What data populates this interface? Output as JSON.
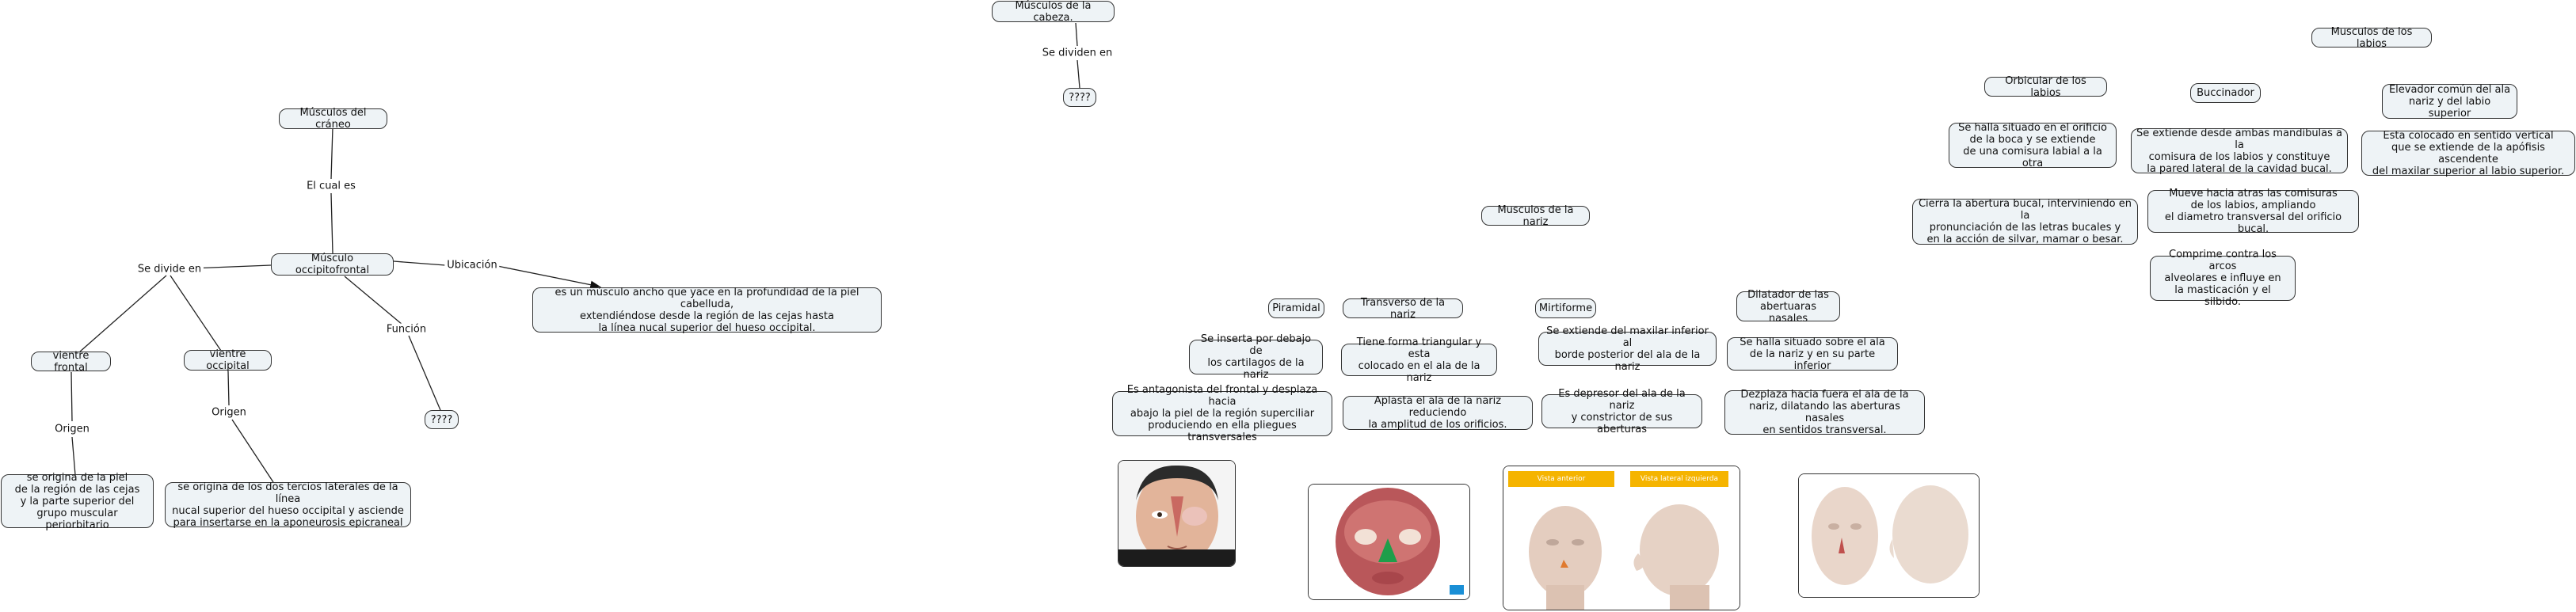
{
  "nodes": {
    "cabeza": "Músculos de la cabeza.",
    "q_top": "????",
    "craneo": "Músculos del cráneo",
    "occipitofrontal": "Músculo occipitofrontal",
    "vientre_frontal": "vientre frontal",
    "vientre_occipital": "vientre occipital",
    "q_funcion": "????",
    "ubicacion_desc": "es un músculo ancho que yace en la profundidad de la piel cabelluda,\nextendiéndose desde la región de las cejas hasta\nla línea nucal superior del hueso occipital.",
    "origen_frontal": "se origina de la piel\nde la región de las cejas\ny la parte superior del\ngrupo muscular periorbitario",
    "origen_occipital": "se origina de los dos tercios laterales de la línea\nnucal superior del hueso occipital y asciende\npara insertarse en la aponeurosis epicraneal",
    "nariz": "Musculos de la nariz",
    "piramidal": "Piramidal",
    "transverso": "Transverso de la nariz",
    "mirtiforme": "Mirtiforme",
    "dilatador": "Dilatador de las\nabertuaras nasales",
    "piramidal_1": "Se inserta por debajo de\nlos cartilagos de la nariz",
    "piramidal_2": "Es antagonista del frontal y desplaza hacia\nabajo la piel de la región superciliar\nproduciendo en ella pliegues transversales",
    "transverso_1": "Tiene forma triangular y esta\ncolocado en el ala de la nariz",
    "transverso_2": "Aplasta el ala de la nariz reduciendo\nla amplitud de los orificios.",
    "mirtiforme_1": "Se extiende del maxilar inferior al\nborde posterior del ala de la nariz",
    "mirtiforme_2": "Es depresor del ala de la nariz\ny constrictor de sus aberturas",
    "dilatador_1": "Se halla situado sobre el ala\nde la nariz y en su parte inferior",
    "dilatador_2": "Dezplaza hacia fuera el ala de la\nnariz, dilatando las aberturas nasales\nen sentidos transversal.",
    "labios": "Musculos de los labios",
    "orbicular": "Orbicular de los labios",
    "buccinador": "Buccinador",
    "elevador": "Elevador común del ala\nnariz y del labio superior",
    "orbicular_1": "Se halla situado en el orificio\nde la boca y se extiende\nde una comisura labial a la otra",
    "orbicular_2": "Cierra la abertura bucal, interviniendo en la\npronunciación de las letras bucales y\nen la acción de silvar, mamar o besar.",
    "buccinador_1": "Se extiende desde ambas mandibulas a la\ncomisura de los labios y constituye\nla pared lateral de la cavidad bucal.",
    "buccinador_2": "Mueve hacia atras las comisuras\nde los labios, ampliando\nel diametro transversal del orificio bucal.",
    "buccinador_3": "Comprime contra los arcos\nalveolares e influye en\nla masticación y el silbido.",
    "elevador_1": "Esta colocado en sentido vertical\nque se extiende de la apófisis ascendente\ndel maxilar superior al labio superior."
  },
  "links": {
    "se_dividen_en": "Se dividen en",
    "el_cual_es": "El cual es",
    "se_divide_en": "Se divide en",
    "ubicacion": "Ubicación",
    "funcion": "Función",
    "origen_1": "Origen",
    "origen_2": "Origen"
  },
  "image_tags": {
    "anterior": "Vista anterior",
    "lateral": "Vista lateral izquierda"
  },
  "colors": {
    "node_fill": "#eef3f6",
    "border": "#333333",
    "tag": "#f5b400",
    "muscle": "#c0504d",
    "nose_highlight": "#1e9e4a",
    "badge": "#1a8fd6"
  }
}
